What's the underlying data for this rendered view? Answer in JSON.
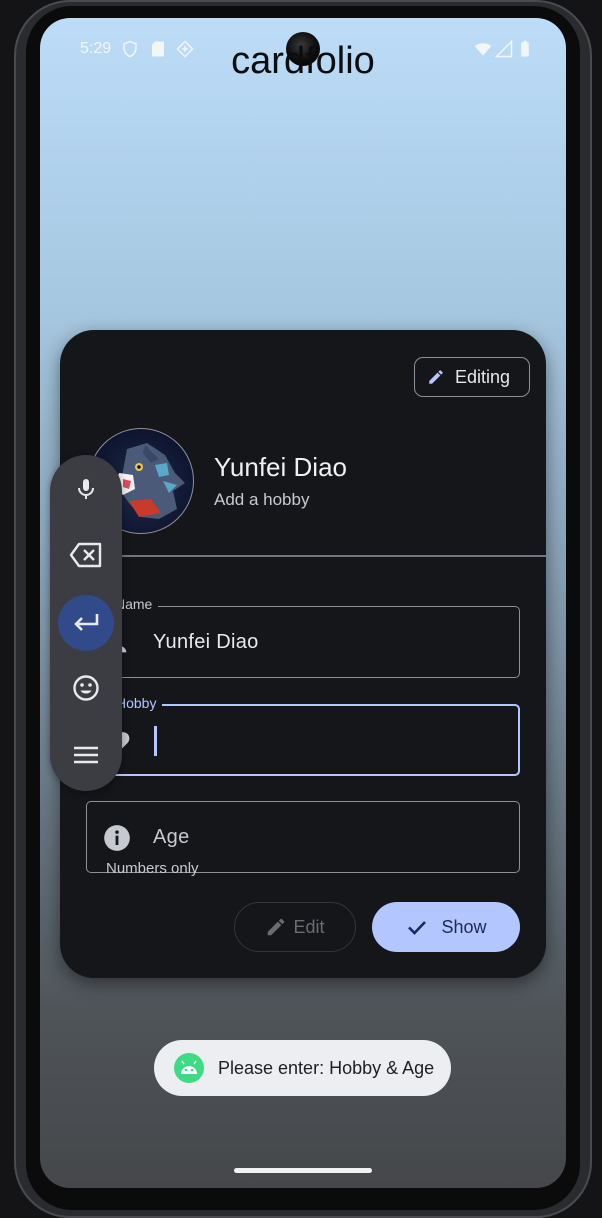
{
  "status_bar": {
    "time": "5:29"
  },
  "app": {
    "title": "cardfolio"
  },
  "card": {
    "mode_chip_label": "Editing",
    "profile_name": "Yunfei Diao",
    "profile_hobby": "Add a hobby",
    "fields": {
      "name": {
        "label": "Name",
        "value": "Yunfei Diao",
        "icon": "person-icon"
      },
      "hobby": {
        "label": "Hobby",
        "value": "",
        "icon": "heart-icon",
        "focused": true
      },
      "age": {
        "placeholder": "Age",
        "supporting_text": "Numbers only",
        "icon": "info-icon"
      }
    },
    "edit_button_label": "Edit",
    "show_button_label": "Show"
  },
  "ime_toolbar": {
    "buttons": [
      "mic-icon",
      "backspace-icon",
      "enter-icon",
      "emoji-icon",
      "menu-icon"
    ],
    "active": "enter-icon"
  },
  "toast": {
    "message": "Please enter: Hobby & Age",
    "icon": "android-icon"
  },
  "colors": {
    "accent": "#b4c6ff",
    "card_background": "#15161a",
    "toast_background": "#eceef1"
  }
}
